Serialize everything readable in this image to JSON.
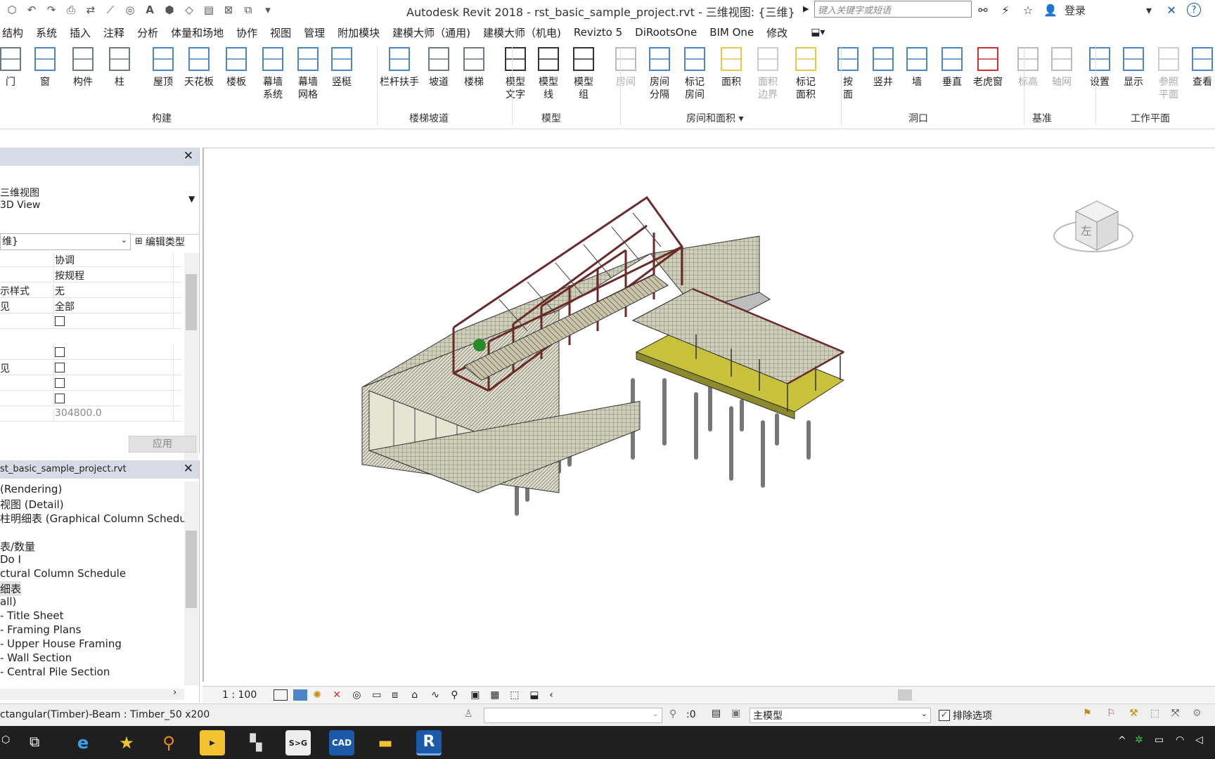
{
  "titlebar": {
    "title": "Autodesk Revit 2018 -   rst_basic_sample_project.rvt - 三维视图: {三维}",
    "search_placeholder": "键入关键字或短语",
    "login": "登录",
    "help": "?"
  },
  "menu": [
    "结构",
    "系统",
    "插入",
    "注释",
    "分析",
    "体量和场地",
    "协作",
    "视图",
    "管理",
    "附加模块",
    "建模大师（通用)",
    "建模大师（机电)",
    "Revizto 5",
    "DiRootsOne",
    "BIM One",
    "修改"
  ],
  "ribbon": {
    "buttons": [
      {
        "label": "门",
        "icon": "door-icon"
      },
      {
        "label": "窗",
        "icon": "window-icon"
      },
      {
        "label": "构件",
        "icon": "component-icon"
      },
      {
        "label": "柱",
        "icon": "column-icon"
      },
      {
        "label": "屋顶",
        "icon": "roof-icon"
      },
      {
        "label": "天花板",
        "icon": "ceiling-icon"
      },
      {
        "label": "楼板",
        "icon": "floor-icon"
      },
      {
        "label": "幕墙\n系统",
        "icon": "curtain-system-icon"
      },
      {
        "label": "幕墙\n网格",
        "icon": "curtain-grid-icon"
      },
      {
        "label": "竖梃",
        "icon": "mullion-icon"
      },
      {
        "label": "栏杆扶手",
        "icon": "railing-icon"
      },
      {
        "label": "坡道",
        "icon": "ramp-icon"
      },
      {
        "label": "楼梯",
        "icon": "stair-icon"
      },
      {
        "label": "模型\n文字",
        "icon": "model-text-icon"
      },
      {
        "label": "模型\n线",
        "icon": "model-line-icon"
      },
      {
        "label": "模型\n组",
        "icon": "model-group-icon"
      },
      {
        "label": "房间",
        "icon": "room-icon"
      },
      {
        "label": "房间\n分隔",
        "icon": "room-separator-icon"
      },
      {
        "label": "标记\n房间",
        "icon": "tag-room-icon"
      },
      {
        "label": "面积",
        "icon": "area-icon"
      },
      {
        "label": "面积\n边界",
        "icon": "area-boundary-icon"
      },
      {
        "label": "标记\n面积",
        "icon": "tag-area-icon"
      },
      {
        "label": "按\n面",
        "icon": "by-face-icon"
      },
      {
        "label": "竖井",
        "icon": "shaft-icon"
      },
      {
        "label": "墙",
        "icon": "wall-opening-icon"
      },
      {
        "label": "垂直",
        "icon": "vertical-opening-icon"
      },
      {
        "label": "老虎窗",
        "icon": "dormer-icon"
      },
      {
        "label": "标高",
        "icon": "level-icon"
      },
      {
        "label": "轴网",
        "icon": "grid-icon"
      },
      {
        "label": "设置",
        "icon": "set-workplane-icon"
      },
      {
        "label": "显示",
        "icon": "show-workplane-icon"
      },
      {
        "label": "参照\n平面",
        "icon": "ref-plane-icon"
      },
      {
        "label": "查看",
        "icon": "viewer-icon"
      }
    ],
    "groups": [
      "构建",
      "楼梯坡道",
      "模型",
      "房间和面积 ▾",
      "洞口",
      "基准",
      "工作平面"
    ]
  },
  "properties": {
    "type_line1": "三维视图",
    "type_line2": "3D View",
    "instance_selector": "维}",
    "edit_type": "编辑类型",
    "rows": [
      {
        "name": "",
        "value": "协调"
      },
      {
        "name": "",
        "value": "按规程"
      },
      {
        "name": "示样式",
        "value": "无"
      },
      {
        "name": "见",
        "value": "全部"
      },
      {
        "name": "",
        "value": "checkbox"
      },
      {
        "name": "",
        "value": "checkbox"
      },
      {
        "name": "见",
        "value": "checkbox"
      },
      {
        "name": "",
        "value": "checkbox"
      },
      {
        "name": "",
        "value": "checkbox"
      },
      {
        "name": "",
        "value": "304800.0"
      }
    ],
    "apply": "应用"
  },
  "browser": {
    "title": "st_basic_sample_project.rvt",
    "items": [
      "(Rendering)",
      "视图 (Detail)",
      "柱明细表 (Graphical Column Schedule",
      "",
      "表/数量",
      " Do I",
      "ctural Column Schedule",
      "细表",
      "all)",
      " - Title Sheet",
      " - Framing Plans",
      " - Upper House Framing",
      " - Wall Section",
      " - Central Pile Section"
    ]
  },
  "viewbar": {
    "scale": "1 : 100"
  },
  "status": {
    "text": "ctangular(Timber)-Beam : Timber_50 x200",
    "selection_count": ":0",
    "model": "主模型",
    "exclude": "排除选项"
  },
  "viewcube": {
    "face": "左"
  },
  "colors": {
    "accent": "#0b5cad",
    "panel_header": "#d6dce5",
    "slab_yellow": "#c8c23a",
    "steel_red": "#6b2a2a"
  }
}
